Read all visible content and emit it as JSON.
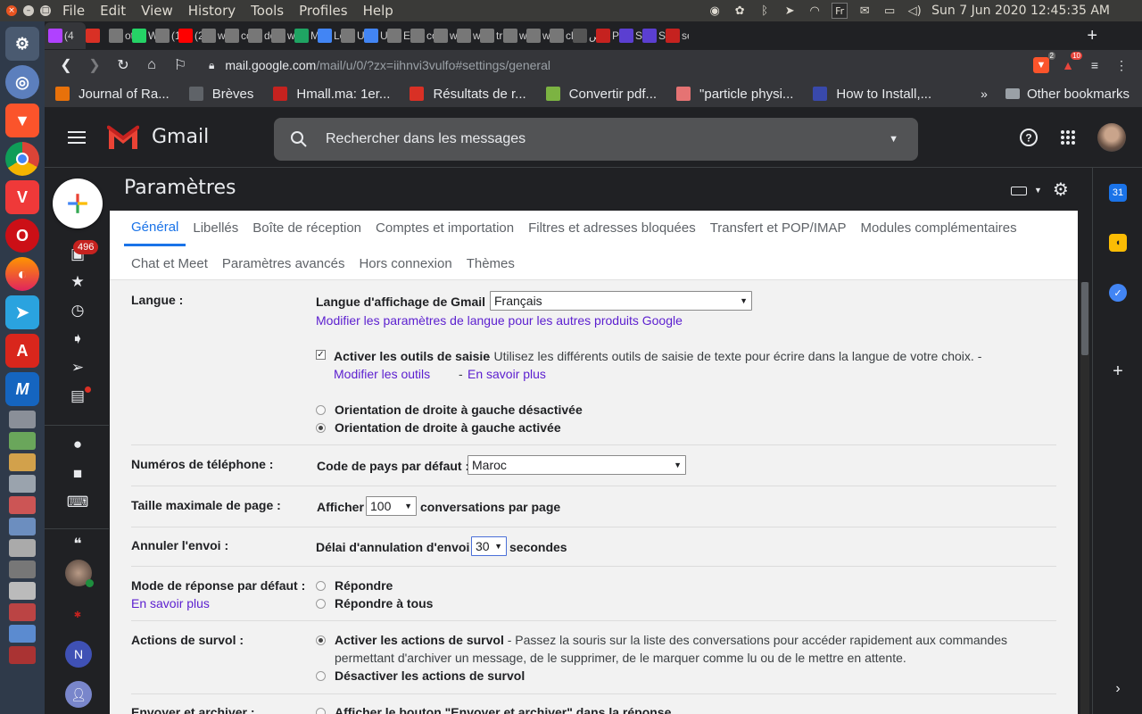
{
  "os": {
    "menu": [
      "File",
      "Edit",
      "View",
      "History",
      "Tools",
      "Profiles",
      "Help"
    ],
    "tray_lang": "Fr",
    "clock": "Sun  7 Jun 2020 12:45:35 AM"
  },
  "browser": {
    "tabs": [
      {
        "label": "(4",
        "icon_color": "#b041ff",
        "active": true
      },
      {
        "label": "",
        "icon_color": "#d93025"
      },
      {
        "label": "ot",
        "icon_color": "#777777"
      },
      {
        "label": "W",
        "icon_color": "#25d366"
      },
      {
        "label": "(1",
        "icon_color": "#777777"
      },
      {
        "label": "(2",
        "icon_color": "#ff0000"
      },
      {
        "label": "w",
        "icon_color": "#777777"
      },
      {
        "label": "cc",
        "icon_color": "#777777"
      },
      {
        "label": "dd",
        "icon_color": "#777777"
      },
      {
        "label": "w",
        "icon_color": "#777777"
      },
      {
        "label": "M",
        "icon_color": "#1fa463"
      },
      {
        "label": "Le",
        "icon_color": "#4285f4"
      },
      {
        "label": "U",
        "icon_color": "#777777"
      },
      {
        "label": "U",
        "icon_color": "#4285f4"
      },
      {
        "label": "Eu",
        "icon_color": "#777777"
      },
      {
        "label": "co",
        "icon_color": "#777777"
      },
      {
        "label": "w",
        "icon_color": "#777777"
      },
      {
        "label": "w",
        "icon_color": "#777777"
      },
      {
        "label": "tr",
        "icon_color": "#777777"
      },
      {
        "label": "w",
        "icon_color": "#777777"
      },
      {
        "label": "w",
        "icon_color": "#777777"
      },
      {
        "label": "cl",
        "icon_color": "#777777"
      },
      {
        "label": "ص",
        "icon_color": "#555555"
      },
      {
        "label": "P",
        "icon_color": "#c5221f"
      },
      {
        "label": "Sc",
        "icon_color": "#5b3fd1"
      },
      {
        "label": "Sc",
        "icon_color": "#5b3fd1"
      },
      {
        "label": "se",
        "icon_color": "#c5221f"
      }
    ],
    "new_tab": "+",
    "url_host": "mail.google.com",
    "url_path": "/mail/u/0/?zx=iihnvi3vulfo#settings/general",
    "ext_badges": [
      "2",
      "10"
    ],
    "bookmarks": [
      {
        "label": "Journal of Ra...",
        "icon_color": "#e8710a"
      },
      {
        "label": "Brèves",
        "icon_color": "#5f6368"
      },
      {
        "label": "Hmall.ma: 1er...",
        "icon_color": "#c5221f"
      },
      {
        "label": "Résultats de r...",
        "icon_color": "#d93025"
      },
      {
        "label": "Convertir pdf...",
        "icon_color": "#7cb342"
      },
      {
        "label": "\"particle physi...",
        "icon_color": "#e57373"
      },
      {
        "label": "How to Install,...",
        "icon_color": "#3949ab"
      }
    ],
    "bookmarks_more": "»",
    "other_bookmarks": "Other bookmarks"
  },
  "gmail": {
    "title": "Gmail",
    "search_placeholder": "Rechercher dans les messages",
    "inbox_count": "496",
    "settings_title": "Paramètres",
    "tabs_row1": [
      "Général",
      "Libellés",
      "Boîte de réception",
      "Comptes et importation",
      "Filtres et adresses bloquées",
      "Transfert et POP/IMAP",
      "Modules complémentaires"
    ],
    "tabs_row2": [
      "Chat et Meet",
      "Paramètres avancés",
      "Hors connexion",
      "Thèmes"
    ],
    "avatar_letter": "N"
  },
  "settings": {
    "langue": {
      "label": "Langue :",
      "display_label": "Langue d'affichage de Gmail :",
      "display_value": "Français",
      "other_products_link": "Modifier les paramètres de langue pour les autres produits Google",
      "input_tools_title": "Activer les outils de saisie",
      "input_tools_desc": " - Utilisez les différents outils de saisie de texte pour écrire dans la langue de votre choix. -",
      "modify_tools": "Modifier les outils",
      "learn_more": "En savoir plus",
      "rtl_off": "Orientation de droite à gauche désactivée",
      "rtl_on": "Orientation de droite à gauche activée"
    },
    "phone": {
      "label": "Numéros de téléphone :",
      "country_label": "Code de pays par défaut :",
      "country_value": "Maroc"
    },
    "page_size": {
      "label": "Taille maximale de page :",
      "prefix": "Afficher",
      "value": "100",
      "suffix": "conversations par page"
    },
    "undo_send": {
      "label": "Annuler l'envoi :",
      "prefix": "Délai d'annulation d'envoi :",
      "value": "30",
      "suffix": "secondes"
    },
    "reply_mode": {
      "label": "Mode de réponse par défaut :",
      "learn_more": "En savoir plus",
      "reply": "Répondre",
      "reply_all": "Répondre à tous"
    },
    "hover": {
      "label": "Actions de survol :",
      "enable_title": "Activer les actions de survol",
      "enable_desc": " - Passez la souris sur la liste des conversations pour accéder rapidement aux commandes",
      "enable_desc2": "permettant d'archiver un message, de le supprimer, de le marquer comme lu ou de le mettre en attente.",
      "disable_title": "Désactiver les actions de survol"
    },
    "send_archive": {
      "label": "Envoyer et archiver :",
      "option": "Afficher le bouton \"Envoyer et archiver\" dans la réponse"
    }
  }
}
